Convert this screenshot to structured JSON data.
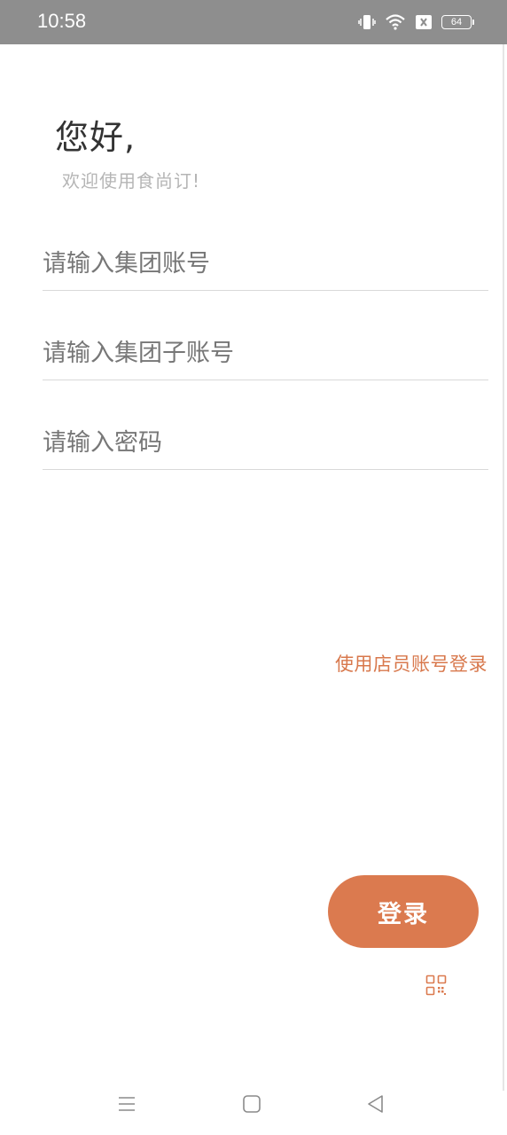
{
  "status_bar": {
    "time": "10:58",
    "battery_level": "64",
    "icons": [
      "vibrate-icon",
      "wifi-icon",
      "sim-blocked-icon",
      "battery-icon"
    ]
  },
  "greeting": {
    "title": "您好,",
    "subtitle": "欢迎使用食尚订!"
  },
  "form": {
    "group_account_placeholder": "请输入集团账号",
    "sub_account_placeholder": "请输入集团子账号",
    "password_placeholder": "请输入密码",
    "group_account_value": "",
    "sub_account_value": "",
    "password_value": ""
  },
  "links": {
    "staff_login": "使用店员账号登录"
  },
  "actions": {
    "login_label": "登录",
    "scan_icon": "qr-code-icon"
  },
  "navigation": {
    "icons": [
      "menu-icon",
      "home-icon",
      "back-icon"
    ]
  },
  "colors": {
    "accent": "#db7a4f",
    "status_bar": "#8e8e8e",
    "link": "#d8784c"
  }
}
